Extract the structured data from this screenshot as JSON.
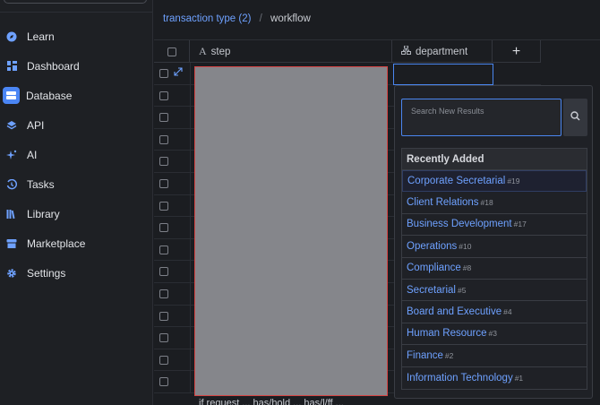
{
  "sidebar": {
    "items": [
      {
        "label": "Learn",
        "icon": "compass-icon",
        "active": false
      },
      {
        "label": "Dashboard",
        "icon": "dashboard-icon",
        "active": false
      },
      {
        "label": "Database",
        "icon": "database-icon",
        "active": true
      },
      {
        "label": "API",
        "icon": "layers-icon",
        "active": false
      },
      {
        "label": "AI",
        "icon": "sparkle-icon",
        "active": false
      },
      {
        "label": "Tasks",
        "icon": "history-icon",
        "active": false
      },
      {
        "label": "Library",
        "icon": "library-icon",
        "active": false
      },
      {
        "label": "Marketplace",
        "icon": "store-icon",
        "active": false
      },
      {
        "label": "Settings",
        "icon": "gear-icon",
        "active": false
      }
    ]
  },
  "breadcrumb": {
    "link": "transaction type (2)",
    "separator": "/",
    "current": "workflow"
  },
  "grid": {
    "columns": {
      "step": "step",
      "department": "department",
      "add": "+"
    },
    "row_count": 15,
    "bottom_text": "if request ... has/hold ... has/l/ff ..."
  },
  "dropdown": {
    "search_placeholder": "Search New Results",
    "section_title": "Recently Added",
    "options": [
      {
        "name": "Corporate Secretarial",
        "num": "#19"
      },
      {
        "name": "Client Relations",
        "num": "#18"
      },
      {
        "name": "Business Development",
        "num": "#17"
      },
      {
        "name": "Operations",
        "num": "#10"
      },
      {
        "name": "Compliance",
        "num": "#8"
      },
      {
        "name": "Secretarial",
        "num": "#5"
      },
      {
        "name": "Board and Executive",
        "num": "#4"
      },
      {
        "name": "Human Resource",
        "num": "#3"
      },
      {
        "name": "Finance",
        "num": "#2"
      },
      {
        "name": "Information Technology",
        "num": "#1"
      }
    ]
  },
  "colors": {
    "accent": "#6ea1ff",
    "active_bg": "#4b86f5",
    "highlight_border": "#d64545",
    "background": "#1b1d21"
  }
}
